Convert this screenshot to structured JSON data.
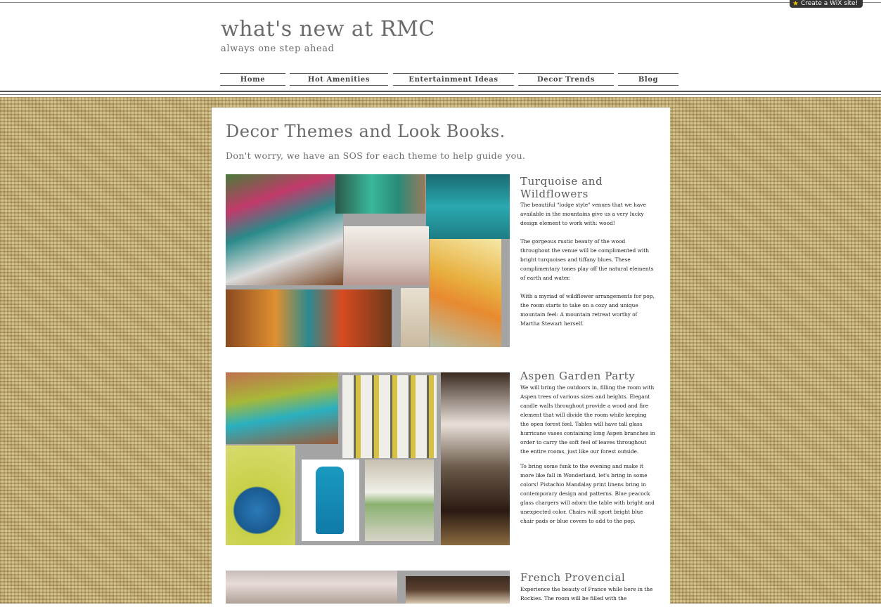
{
  "wix_badge": {
    "label": "Create a WiX site!"
  },
  "header": {
    "title": "what's new at RMC",
    "tagline": "always one step ahead"
  },
  "nav": {
    "items": [
      {
        "label": "Home"
      },
      {
        "label": "Hot Amenities"
      },
      {
        "label": "Entertainment Ideas"
      },
      {
        "label": "Decor Trends"
      },
      {
        "label": "Blog"
      }
    ]
  },
  "page": {
    "title": "Decor Themes and Look Books.",
    "subtitle": "Don't worry, we have an SOS for each theme to help guide you."
  },
  "sections": [
    {
      "title": "Turquoise and Wildflowers",
      "paragraphs": [
        "The beautiful \"lodge style\" venues that we have available in the mountains give us a very lucky design element to work with: wood!",
        "The gorgeous rustic beauty of the wood throughout the venue will be complimented with bright turquoises and tiffany blues. These complimentary tones play off the natural elements of earth and water.",
        "With a myriad of wildflower arrangements for pop, the room starts to take on a cozy and unique mountain feel: A mountain retreat worthy of Martha Stewart herself."
      ]
    },
    {
      "title": "Aspen Garden Party",
      "paragraphs": [
        "We will bring the outdoors in, filling the room with Aspen trees of various sizes and heights. Elegant candle walls throughout provide a wood and fire element that will divide the room while keeping the open forest feel. Tables will have tall glass hurricane vases containing long Aspen branches in order to carry the soft feel of leaves throughout the entire rooms, just like our forest outside.",
        "To bring some funk to the evening and make it more like fall in Wonderland, let's bring in some colors! Pistachio Mandalay print linens bring in contemporary design and patterns. Blue peacock glass chargers will adorn the table with bright and unexpected color. Chairs will sport bright blue chair pads or blue covers to add to the pop."
      ]
    },
    {
      "title": "French Provencial",
      "paragraphs": [
        "Experience the beauty of France while here in the Rockies. The room will be filled with the"
      ]
    }
  ]
}
